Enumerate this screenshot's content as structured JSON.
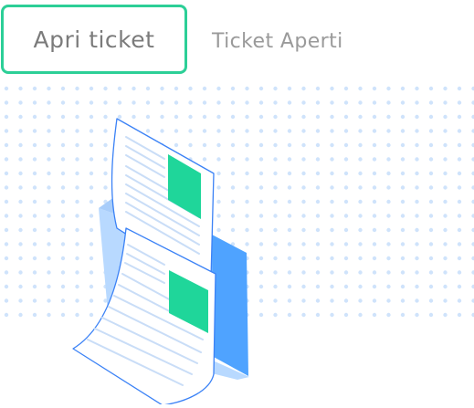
{
  "tabs": {
    "open_ticket_label": "Apri ticket",
    "open_tickets_label": "Ticket Aperti"
  },
  "colors": {
    "accent": "#2ccf97",
    "dot": "#cfe3fb",
    "folder_dark": "#4fa3ff",
    "folder_light": "#b8d9ff",
    "paper_outline": "#3b82f6",
    "paper_line": "#c9ddf7",
    "green_block": "#1fd69a"
  },
  "icons": {
    "illustration": "documents-folder-icon"
  }
}
